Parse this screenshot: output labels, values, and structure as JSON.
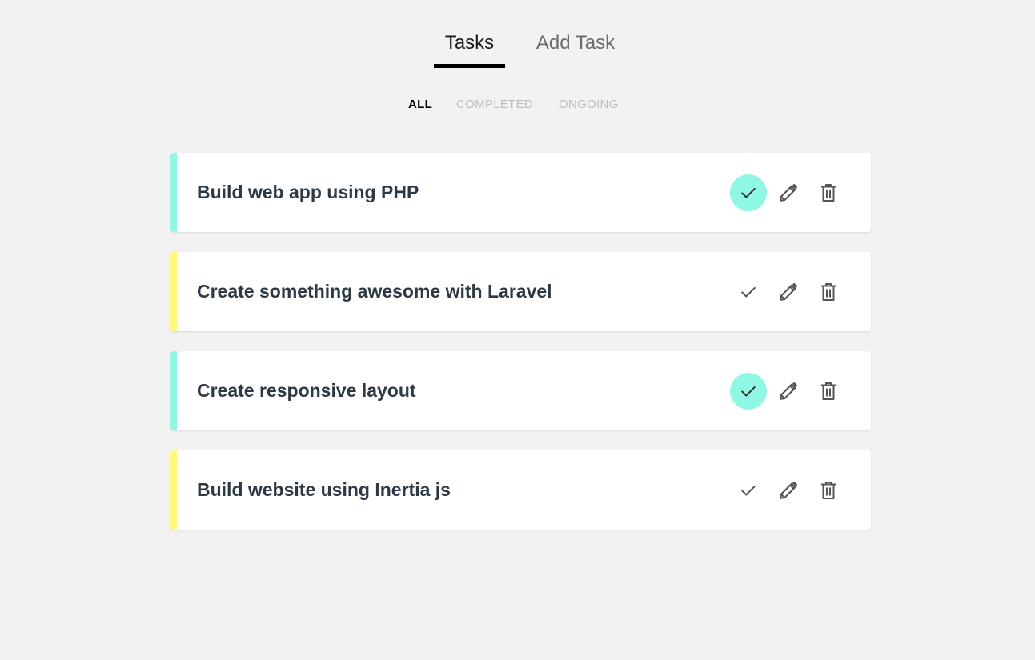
{
  "tabs": {
    "tasks_label": "Tasks",
    "add_task_label": "Add Task"
  },
  "filters": {
    "all": "ALL",
    "completed": "COMPLETED",
    "ongoing": "ONGOING"
  },
  "colors": {
    "completed_bar": "#8ef8e4",
    "ongoing_bar": "#fff975",
    "check_active_bg": "#8ef8e4"
  },
  "icons": {
    "check": "check-icon",
    "edit": "pencil-icon",
    "delete": "trash-icon"
  },
  "tasks": [
    {
      "title": "Build web app using PHP",
      "completed": true
    },
    {
      "title": "Create something awesome with Laravel",
      "completed": false
    },
    {
      "title": "Create responsive layout",
      "completed": true
    },
    {
      "title": "Build website using Inertia js",
      "completed": false
    }
  ]
}
